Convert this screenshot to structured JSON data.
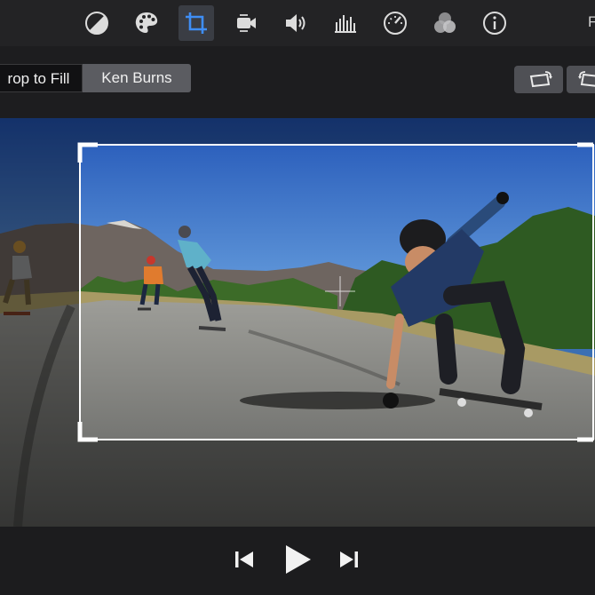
{
  "toolbar": {
    "tools": [
      {
        "icon": "color-balance-icon",
        "label": "Color Balance"
      },
      {
        "icon": "color-palette-icon",
        "label": "Color Correction"
      },
      {
        "icon": "crop-icon",
        "label": "Cropping",
        "active": true
      },
      {
        "icon": "stabilization-icon",
        "label": "Stabilization"
      },
      {
        "icon": "volume-icon",
        "label": "Volume"
      },
      {
        "icon": "equalizer-icon",
        "label": "Noise Reduction and Equalizer"
      },
      {
        "icon": "speed-icon",
        "label": "Speed"
      },
      {
        "icon": "filter-icon",
        "label": "Clip Filter"
      },
      {
        "icon": "info-icon",
        "label": "Info"
      }
    ],
    "right_label": "F"
  },
  "crop_modes": {
    "crop_to_fill": "rop to Fill",
    "ken_burns": "Ken Burns"
  },
  "rotate": {
    "counterclockwise_icon": "rotate-left-icon",
    "clockwise_icon": "rotate-right-icon"
  },
  "transport": {
    "previous_icon": "skip-back-icon",
    "play_icon": "play-icon",
    "next_icon": "skip-forward-icon"
  },
  "colors": {
    "toolbar_bg": "#232325",
    "active_tool_bg": "#3a3d44",
    "crop_accent": "#3f8ef5",
    "icon_color": "#dcdcdc"
  }
}
